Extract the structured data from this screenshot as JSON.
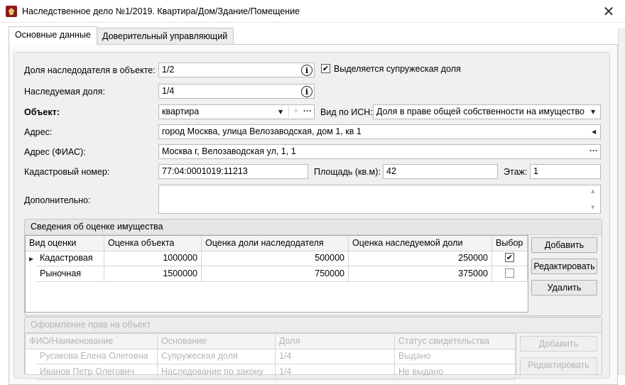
{
  "window": {
    "title": "Наследственное дело №1/2019. Квартира/Дом/Здание/Помещение",
    "close_glyph": "✕"
  },
  "tabs": [
    {
      "label": "Основные данные",
      "active": true
    },
    {
      "label": "Доверительный управляющий",
      "active": false
    }
  ],
  "form": {
    "share_label": "Доля наследодателя в объекте:",
    "share_value": "1/2",
    "spouse_label": "Выделяется супружеская доля",
    "spouse_checked": "✔",
    "inherited_label": "Наследуемая доля:",
    "inherited_value": "1/4",
    "object_label": "Объект:",
    "object_value": "квартира",
    "isn_label": "Вид по ИСН:",
    "isn_value": "Доля в праве общей собственности на имущество",
    "address_label": "Адрес:",
    "address_value": "город Москва, улица Велозаводская, дом 1, кв 1",
    "fias_label": "Адрес (ФИАС):",
    "fias_value": "Москва г, Велозаводская ул, 1, 1",
    "cadastral_label": "Кадастровый номер:",
    "cadastral_value": "77:04:0001019:11213",
    "area_label": "Площадь (кв.м):",
    "area_value": "42",
    "floor_label": "Этаж:",
    "floor_value": "1",
    "extra_label": "Дополнительно:",
    "info_glyph": "i",
    "dots_glyph": "···",
    "plus_glyph": "+",
    "arrow_down": "▼",
    "arrow_left": "◀"
  },
  "valuation": {
    "title": "Сведения об оценке имущества",
    "columns": [
      "Вид оценки",
      "Оценка объекта",
      "Оценка доли наследодателя",
      "Оценка наследуемой доли",
      "Выбор"
    ],
    "rows": [
      {
        "type": "Кадастровая",
        "object": "1000000",
        "share": "500000",
        "inherited": "250000",
        "selected": "✔"
      },
      {
        "type": "Рыночная",
        "object": "1500000",
        "share": "750000",
        "inherited": "375000",
        "selected": ""
      }
    ],
    "buttons": {
      "add": "Добавить",
      "edit": "Редактировать",
      "delete": "Удалить"
    }
  },
  "rights": {
    "title": "Оформление прав на объект",
    "columns": [
      "ФИО/Наименование",
      "Основание",
      "Доля",
      "Статус свидетельства"
    ],
    "rows": [
      {
        "name": "Русакова Елена Олеговна",
        "basis": "Супружеская доля",
        "share": "1/4",
        "status": "Выдано"
      },
      {
        "name": "Иванов Петр Олегович",
        "basis": "Наследование по закону",
        "share": "1/4",
        "status": "Не выдано"
      }
    ],
    "buttons": {
      "add": "Добавить",
      "edit": "Редактировать"
    }
  }
}
